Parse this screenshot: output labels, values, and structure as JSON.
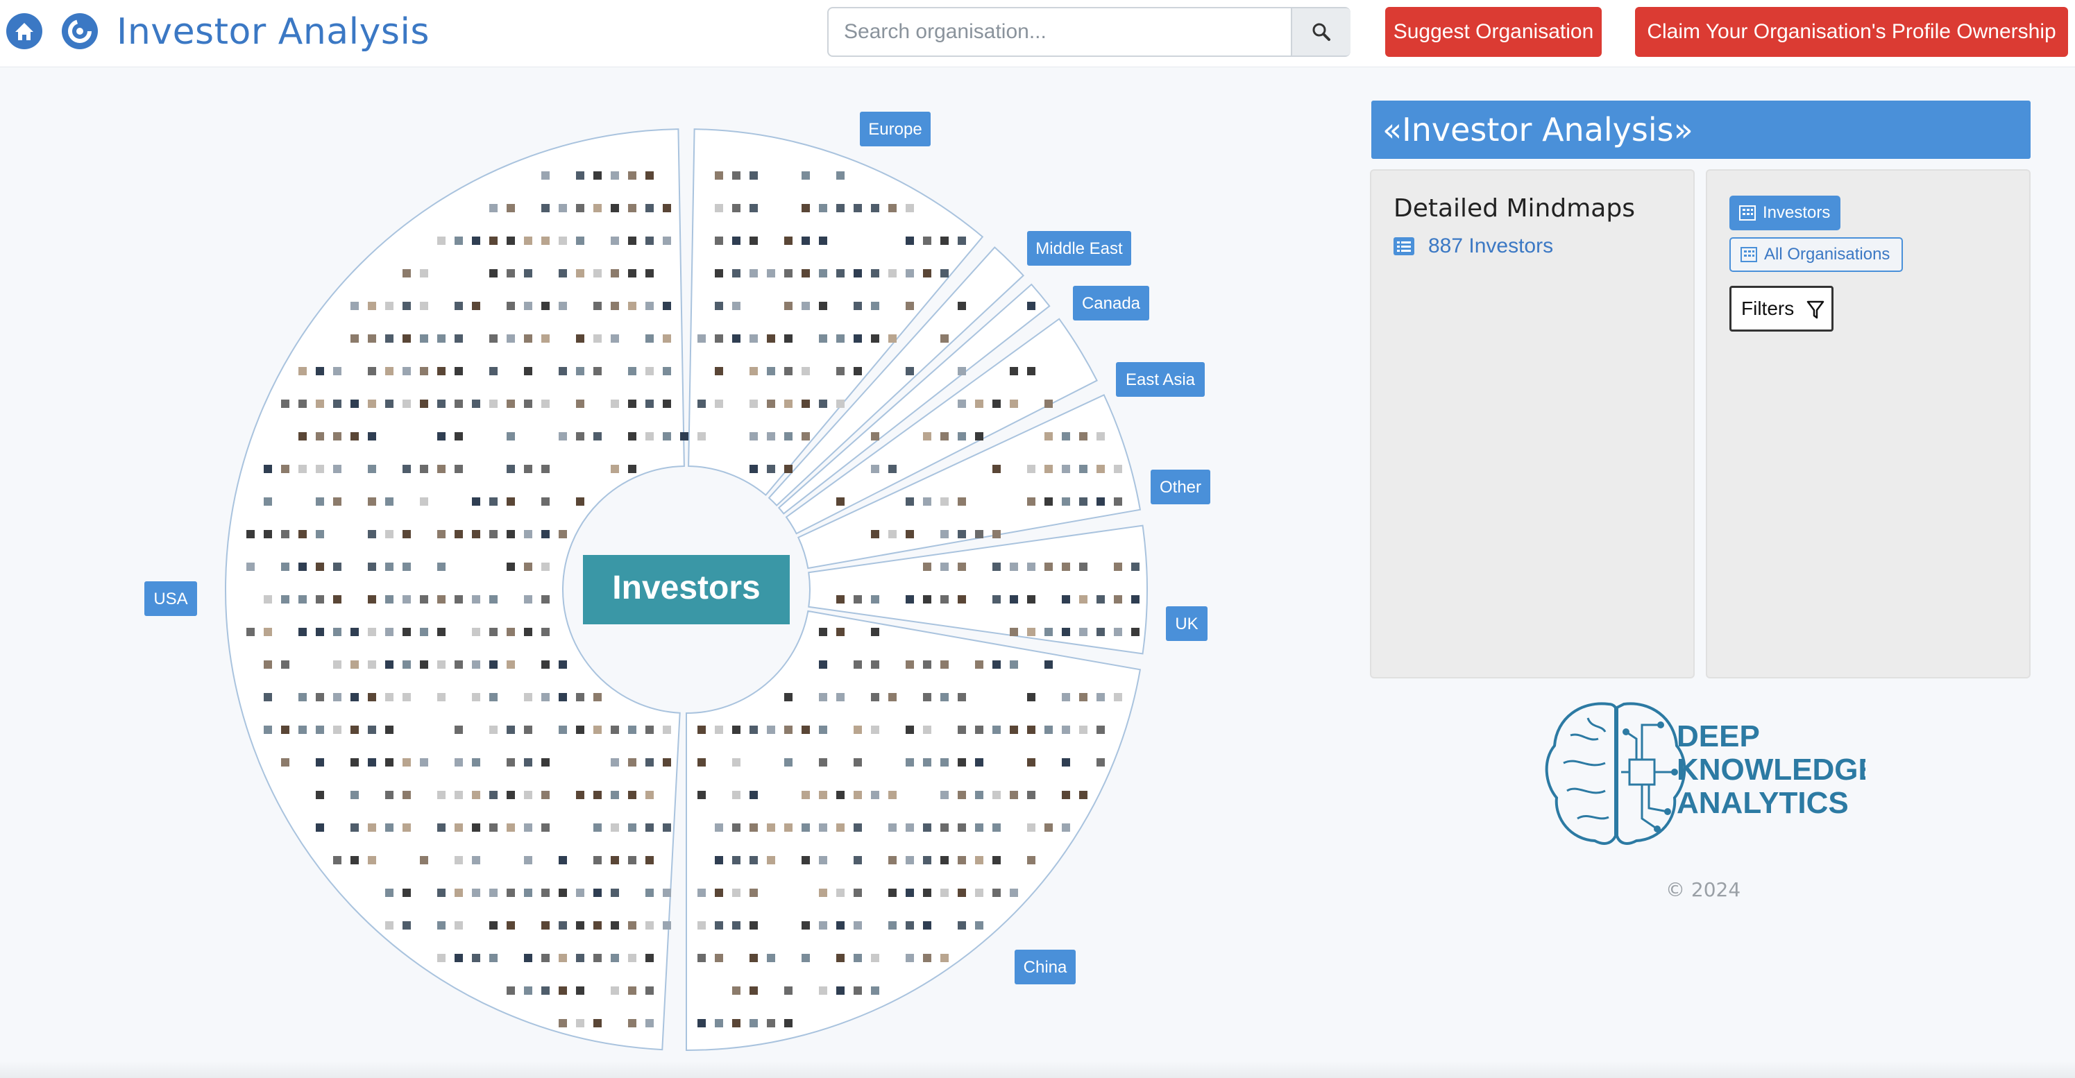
{
  "header": {
    "title": "Investor Analysis",
    "search_placeholder": "Search organisation...",
    "suggest_label": "Suggest Organisation",
    "claim_label": "Claim Your Organisation's Profile Ownership",
    "home_icon": "home-icon",
    "logo_icon": "refresh-logo-icon",
    "search_icon": "search-icon"
  },
  "mindmap": {
    "center_label": "Investors",
    "regions": [
      "USA",
      "Europe",
      "Middle East",
      "Canada",
      "East Asia",
      "Other",
      "UK",
      "China"
    ],
    "colors": {
      "center": "#3a97a6",
      "region_label": "#4a90d9",
      "outline": "#a9c3de"
    }
  },
  "panel": {
    "title": "«Investor Analysis»",
    "mindmaps_heading": "Detailed Mindmaps",
    "mindmaps_link": "887 Investors",
    "tag_investors": "Investors",
    "tag_all": "All Organisations",
    "filters_label": "Filters"
  },
  "brand": {
    "line1": "DEEP",
    "line2": "KNOWLEDGE",
    "line3": "ANALYTICS",
    "copyright": "© 2024"
  },
  "colors": {
    "accent": "#4a90d9",
    "title_blue": "#3b78c4",
    "button_red": "#db3b33",
    "brand_teal": "#2c7aa3"
  }
}
